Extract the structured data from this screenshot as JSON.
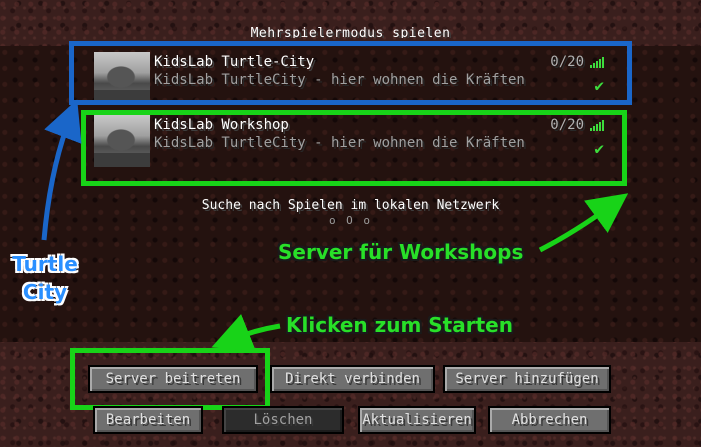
{
  "screen": {
    "title": "Mehrspielermodus spielen",
    "scan_text": "Suche nach Spielen im lokalen Netzwerk",
    "scan_dots": "o O o"
  },
  "servers": [
    {
      "name": "KidsLab Turtle-City",
      "motd": "KidsLab TurtleCity - hier wohnen die Kräften",
      "players": "0/20",
      "signal": "5 bars",
      "status_icon": "check-icon"
    },
    {
      "name": "KidsLab Workshop",
      "motd": "KidsLab TurtleCity - hier wohnen die Kräften",
      "players": "0/20",
      "signal": "5 bars",
      "status_icon": "check-icon"
    }
  ],
  "buttons": {
    "join": "Server beitreten",
    "direct": "Direkt verbinden",
    "add": "Server hinzufügen",
    "edit": "Bearbeiten",
    "delete": "Löschen",
    "refresh": "Aktualisieren",
    "cancel": "Abbrechen"
  },
  "annotations": {
    "turtle_city_line1": "Turtle",
    "turtle_city_line2": "City",
    "workshop": "Server für Workshops",
    "start": "Klicken zum Starten"
  },
  "colors": {
    "annotation_blue": "#1a66c9",
    "annotation_green": "#18d318",
    "signal_green": "#3ddc3d"
  }
}
